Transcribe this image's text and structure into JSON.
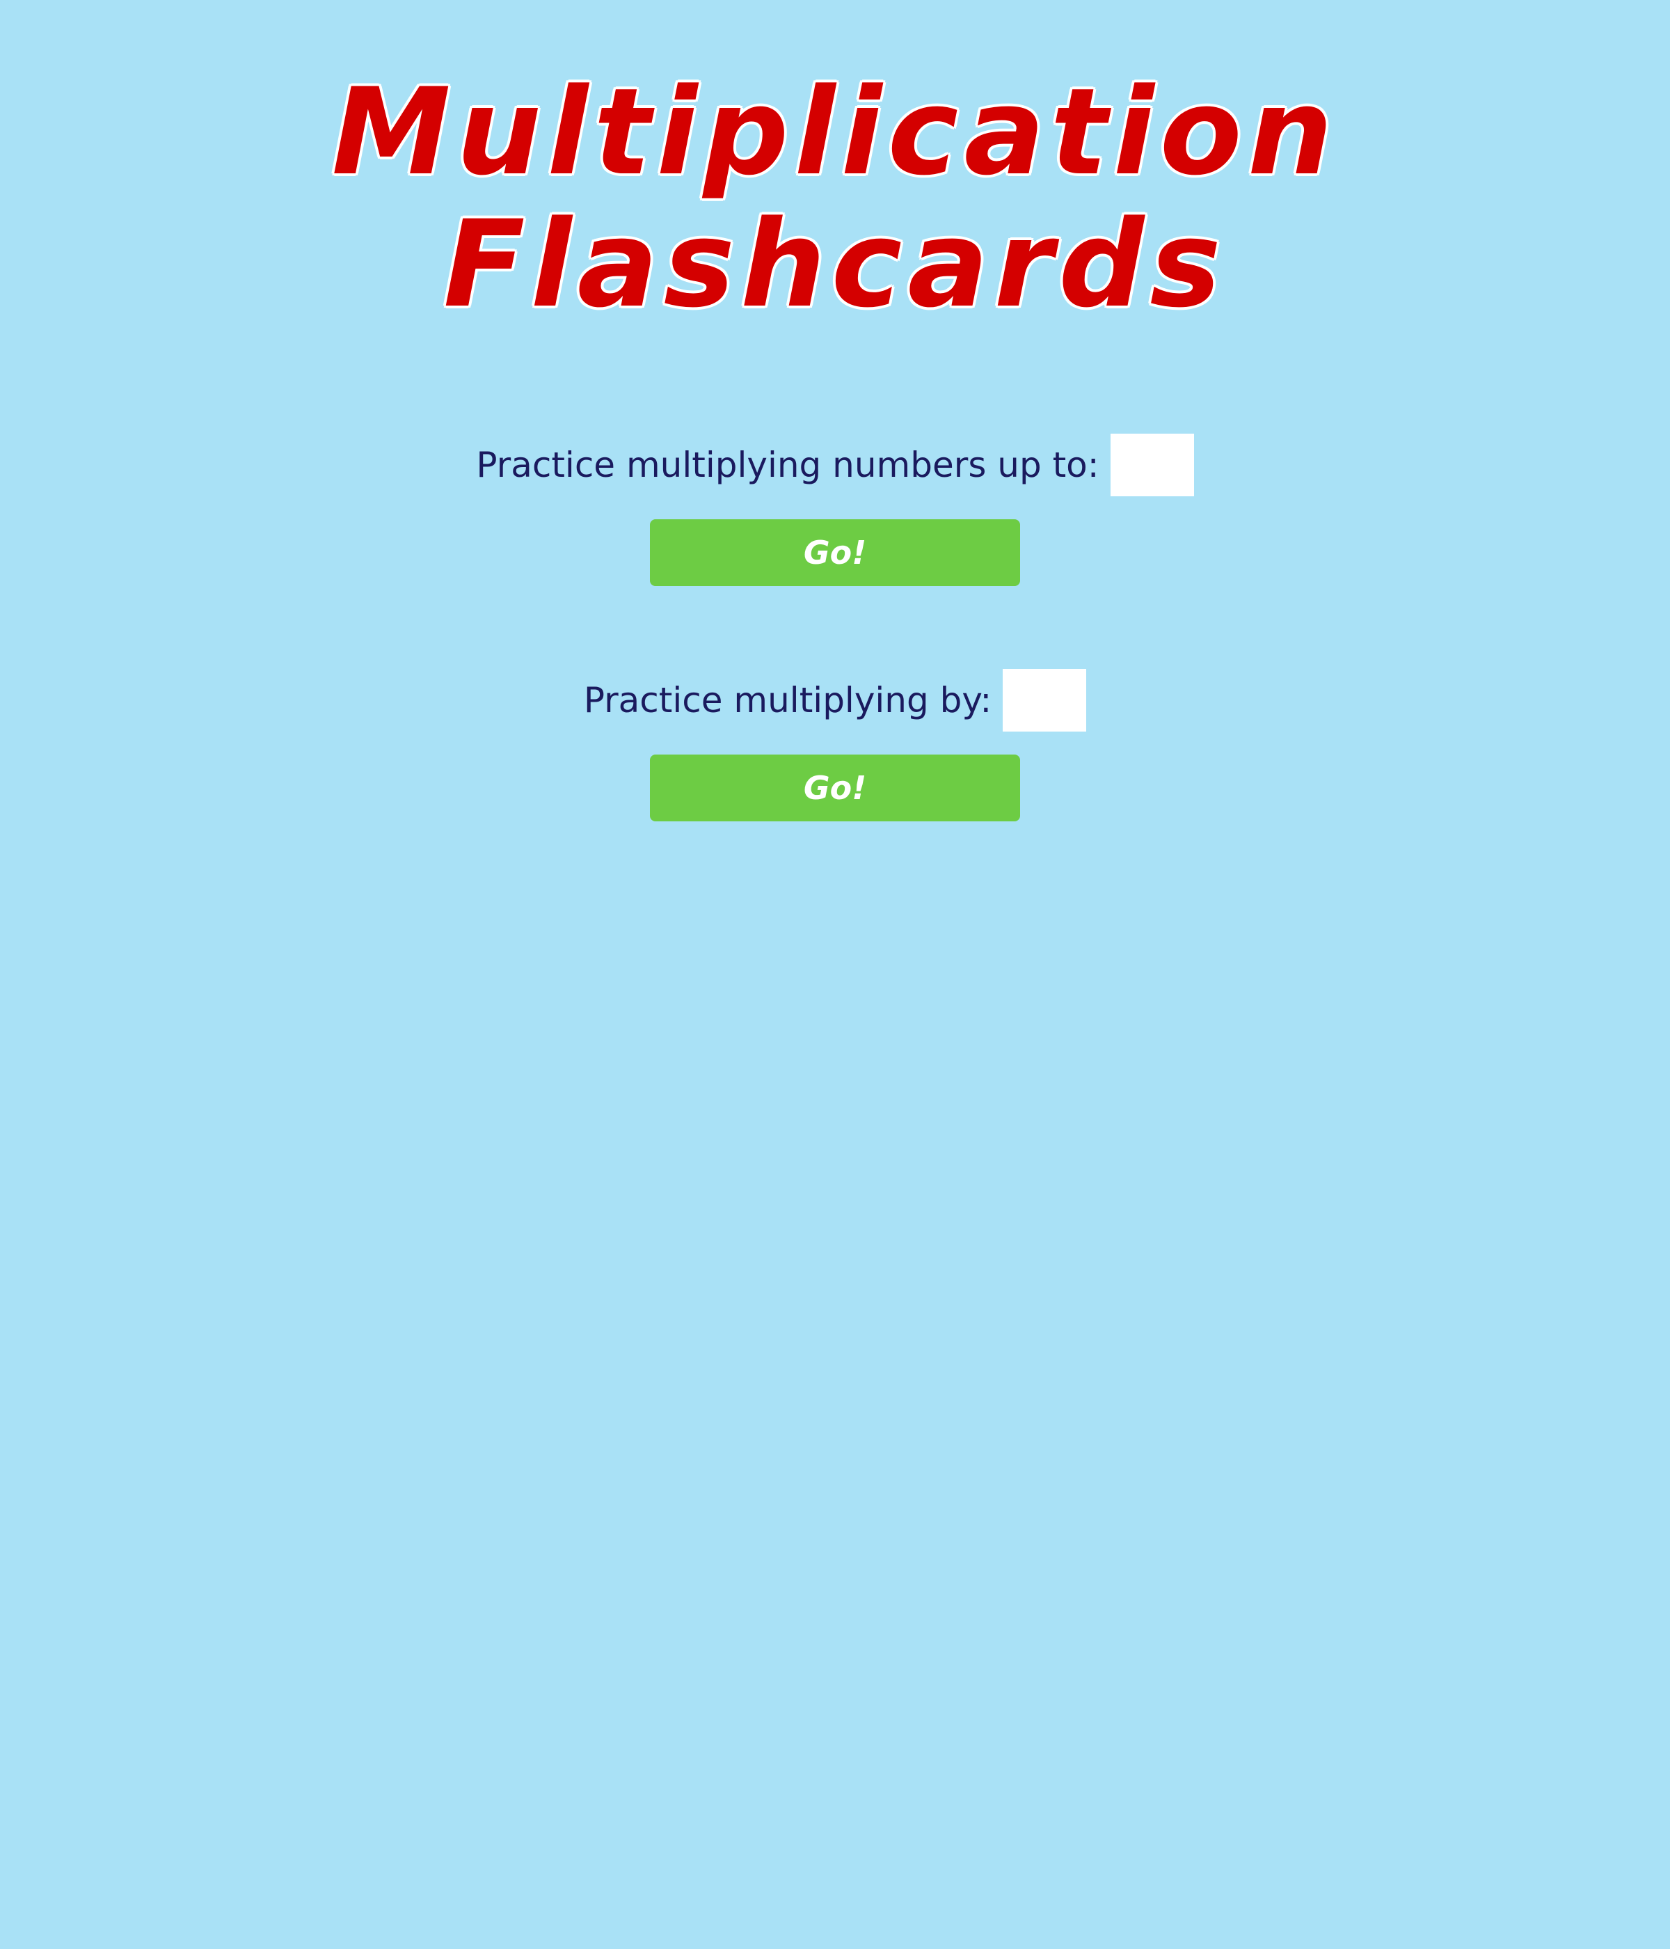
{
  "title": {
    "line1": "Multiplication",
    "line2": "Flashcards"
  },
  "up_to": {
    "label": "Practice multiplying numbers up to:",
    "value": "",
    "button_label": "Go!"
  },
  "by": {
    "label": "Practice multiplying by:",
    "value": "",
    "button_label": "Go!"
  },
  "colors": {
    "background": "#a9e1f6",
    "title": "#d40000",
    "title_outline": "#ffffff",
    "label_text": "#1a1a5e",
    "button": "#6dcc44",
    "button_text": "#ffffff",
    "input": "#ffffff"
  }
}
